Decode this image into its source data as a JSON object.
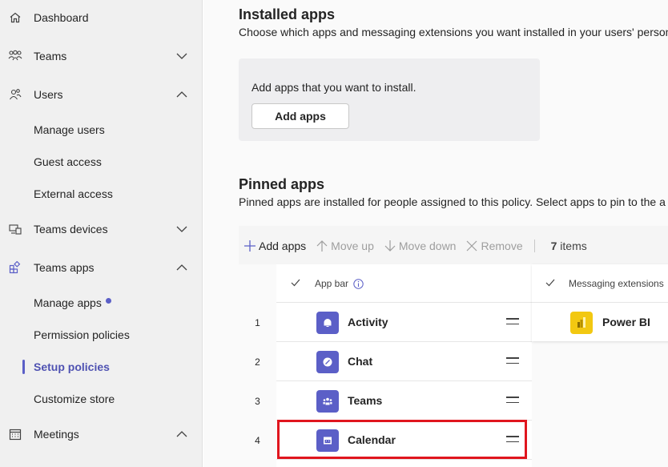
{
  "sidebar": {
    "items": [
      {
        "label": "Dashboard",
        "icon": "home-icon"
      },
      {
        "label": "Teams",
        "icon": "teams-group-icon",
        "chevron": "down"
      },
      {
        "label": "Users",
        "icon": "users-icon",
        "chevron": "up"
      },
      {
        "label": "Manage users"
      },
      {
        "label": "Guest access"
      },
      {
        "label": "External access"
      },
      {
        "label": "Teams devices",
        "icon": "devices-icon",
        "chevron": "down"
      },
      {
        "label": "Teams apps",
        "icon": "apps-icon",
        "chevron": "up"
      },
      {
        "label": "Manage apps",
        "badge": "dot"
      },
      {
        "label": "Permission policies"
      },
      {
        "label": "Setup policies",
        "active": true
      },
      {
        "label": "Customize store"
      },
      {
        "label": "Meetings",
        "icon": "calendar-icon",
        "chevron": "up"
      }
    ]
  },
  "installed": {
    "title": "Installed apps",
    "description": "Choose which apps and messaging extensions you want installed in your users' person",
    "card_text": "Add apps that you want to install.",
    "add_button": "Add apps"
  },
  "pinned": {
    "title": "Pinned apps",
    "description": "Pinned apps are installed for people assigned to this policy. Select apps to pin to the a",
    "toolbar": {
      "add": "Add apps",
      "move_up": "Move up",
      "move_down": "Move down",
      "remove": "Remove",
      "count_num": "7",
      "count_label": "items"
    },
    "app_bar_header": "App bar",
    "messaging_header": "Messaging extensions",
    "rows": [
      {
        "num": "1",
        "name": "Activity",
        "icon": "bell-icon"
      },
      {
        "num": "2",
        "name": "Chat",
        "icon": "chat-icon"
      },
      {
        "num": "3",
        "name": "Teams",
        "icon": "teams-icon"
      },
      {
        "num": "4",
        "name": "Calendar",
        "icon": "calendar-icon"
      }
    ],
    "messaging_rows": [
      {
        "name": "Power BI",
        "icon": "powerbi-icon"
      }
    ]
  },
  "colors": {
    "accent": "#5b5fc7",
    "highlight": "#e0161e",
    "powerbi": "#f2c811"
  }
}
